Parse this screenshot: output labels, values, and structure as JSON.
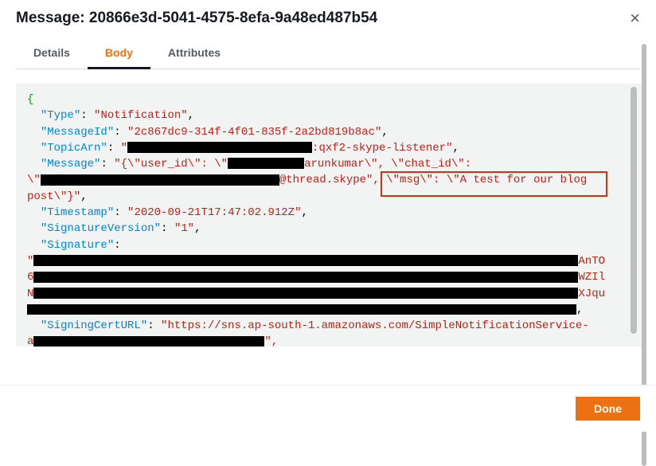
{
  "header": {
    "title": "Message: 20866e3d-5041-4575-8efa-9a48ed487b54",
    "close_label": "×"
  },
  "tabs": {
    "details": "Details",
    "body": "Body",
    "attributes": "Attributes",
    "active": "body"
  },
  "body": {
    "open_brace": "{",
    "close_fragment": "}",
    "pairs": {
      "type_key": "\"Type\"",
      "type_val": "\"Notification\"",
      "messageid_key": "\"MessageId\"",
      "messageid_val": "\"2c867dc9-314f-4f01-835f-2a2bd819b8ac\"",
      "topicarn_key": "\"TopicArn\"",
      "topicarn_val_suffix": ":qxf2-skype-listener\"",
      "message_key": "\"Message\"",
      "message_val_p1": "\"{\\\"user_id\\\": \\\"",
      "message_val_mid1": "arunkumar\\\", \\\"chat_id\\\":",
      "message_val_lead2": "\\\"",
      "message_val_mid2": "@thread.skype\", ",
      "message_highlight": "\\\"msg\\\": \\\"A test for our blog",
      "message_val_tail": "post\\\"}\"",
      "timestamp_key": "\"Timestamp\"",
      "timestamp_val": "\"2020-09-21T17:47:02.912Z\"",
      "sigver_key": "\"SignatureVersion\"",
      "sigver_val": "\"1\"",
      "signature_key": "\"Signature\"",
      "sig_tail1": "AnTO",
      "sig_lead2": "6",
      "sig_tail2": "WZIl",
      "sig_lead3": "N",
      "sig_tail3": "XJqu",
      "sig_lead4": "",
      "signingcert_key": "\"SigningCertURL\"",
      "signingcert_val_head": "\"https://sns.ap-south-1.amazonaws.com/SimpleNotificationService-",
      "signingcert_lead": "a",
      "signingcert_tail": "\","
    }
  },
  "footer": {
    "done": "Done"
  },
  "colors": {
    "primary": "#ec7211",
    "border": "#d5dbdb",
    "bg_code": "#f2f3f3"
  }
}
